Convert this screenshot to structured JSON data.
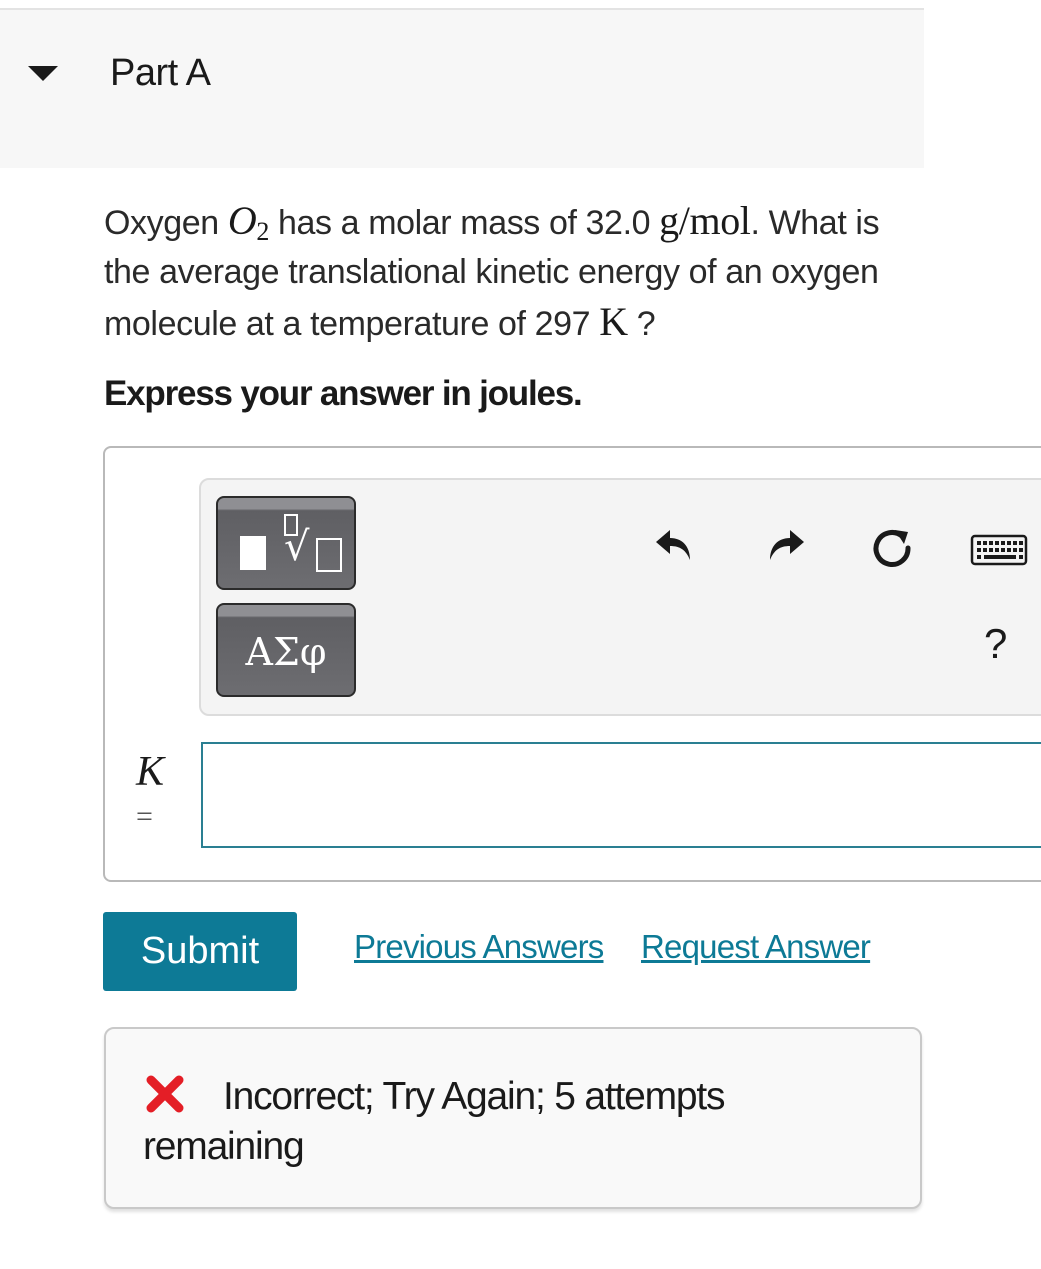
{
  "part": {
    "title": "Part A"
  },
  "question": {
    "text_1": "Oxygen ",
    "species_symbol": "O",
    "species_subscript": "2",
    "text_2": " has a molar mass of 32.0 ",
    "molar_mass_unit": "g/mol",
    "text_3": ". What is the average translational kinetic energy of an oxygen molecule at a temperature of 297 ",
    "temperature_unit": "K",
    "text_4": " ?"
  },
  "instruction": "Express your answer in joules.",
  "toolbar": {
    "symbols_label": "ΑΣφ",
    "help_label": "?",
    "icons": [
      "templates-icon",
      "undo-icon",
      "redo-icon",
      "reset-icon",
      "keyboard-icon",
      "help-icon"
    ]
  },
  "answer": {
    "variable": "K",
    "equals": "=",
    "value": "",
    "placeholder": ""
  },
  "actions": {
    "submit_label": "Submit",
    "previous_answers_label": "Previous Answers",
    "request_answer_label": "Request Answer"
  },
  "feedback": {
    "message": "Incorrect; Try Again; 5 attempts remaining",
    "status_color": "#e41e26"
  },
  "colors": {
    "accent": "#0d7a96",
    "input_border": "#2a7f92",
    "header_bg": "#f7f7f7"
  }
}
